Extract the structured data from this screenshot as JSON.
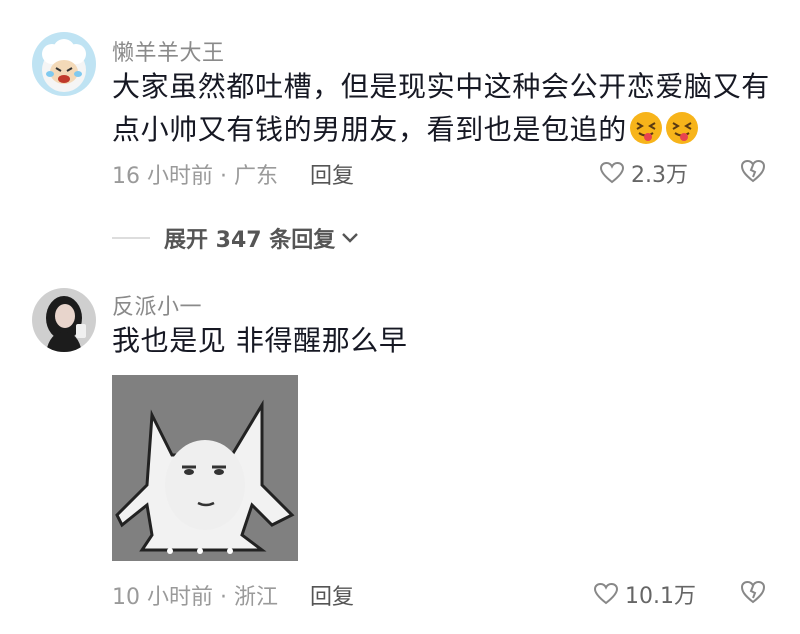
{
  "comments": [
    {
      "username": "懒羊羊大王",
      "text": "大家虽然都吐槽，但是现实中这种会公开恋爱脑又有",
      "text_line2": "点小帅又有钱的男朋友，看到也是包追的",
      "emoji": "squinting-tongue-emoji",
      "time_location": "16 小时前 · 广东",
      "reply_label": "回复",
      "like_count": "2.3万",
      "expand_replies": "展开 347 条回复"
    },
    {
      "username": "反派小一",
      "text": "我也是见 非得醒那么早",
      "sticker": "cat-meme-sticker",
      "time_location": "10 小时前 · 浙江",
      "reply_label": "回复",
      "like_count": "10.1万"
    }
  ],
  "colors": {
    "text": "#161823",
    "username": "#8a8a8a",
    "meta": "#9a9a9a"
  }
}
